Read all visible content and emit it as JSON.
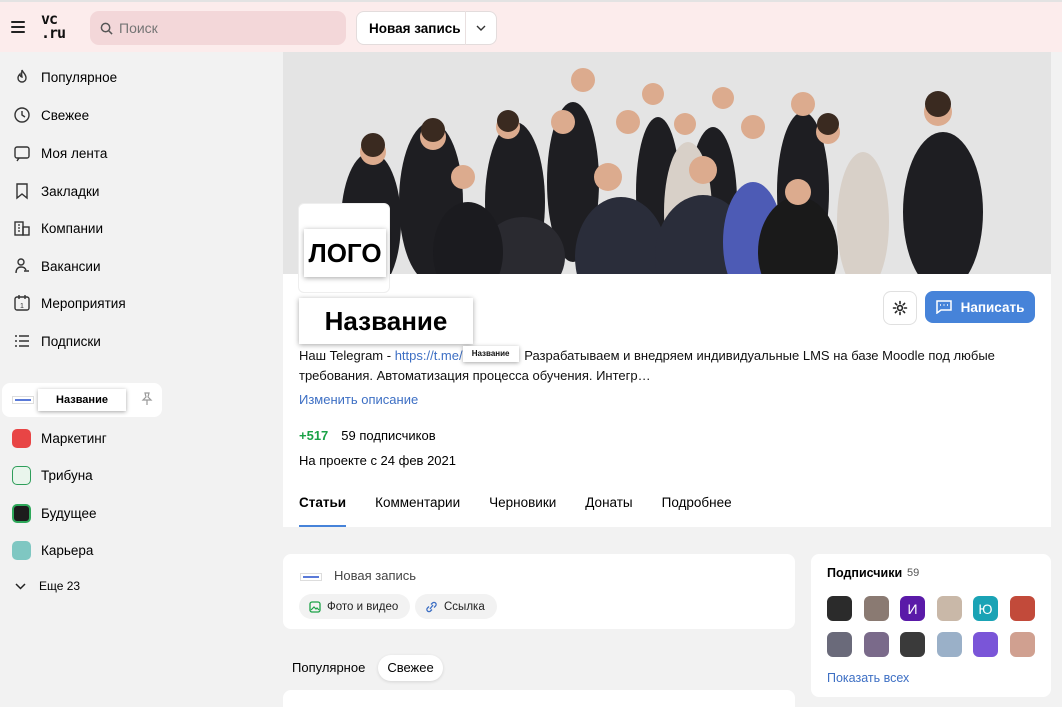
{
  "header": {
    "logo_top": "vc",
    "logo_bottom": ".ru",
    "search_placeholder": "Поиск",
    "new_post_label": "Новая запись"
  },
  "sidebar": {
    "items": [
      {
        "label": "Популярное",
        "icon": "fire-icon"
      },
      {
        "label": "Свежее",
        "icon": "clock-icon"
      },
      {
        "label": "Моя лента",
        "icon": "feed-icon"
      },
      {
        "label": "Закладки",
        "icon": "bookmark-icon"
      },
      {
        "label": "Компании",
        "icon": "building-icon"
      },
      {
        "label": "Вакансии",
        "icon": "person-icon"
      },
      {
        "label": "Мероприятия",
        "icon": "calendar-icon"
      },
      {
        "label": "Подписки",
        "icon": "list-icon"
      }
    ],
    "current_sub": "Название",
    "subs": [
      {
        "label": "Маркетинг",
        "color": "#e84545"
      },
      {
        "label": "Трибуна",
        "color": "#2e9e5a"
      },
      {
        "label": "Будущее",
        "color": "#1c1c1c"
      },
      {
        "label": "Карьера",
        "color": "#7fc7c2"
      }
    ],
    "more_label": "Еще 23"
  },
  "profile": {
    "logo_text": "ЛОГО",
    "name": "Название",
    "write_label": "Написать",
    "desc_prefix": "Наш Telegram - ",
    "desc_link": "https://t.me/",
    "desc_badge": "Название",
    "desc_rest": " Разрабатываем и внедряем индивидуальные LMS на базе Moodle под любые требования. Автоматизация процесса обучения. Интегр…",
    "edit_desc": "Изменить описание",
    "karma": "+517",
    "subscribers": "59 подписчиков",
    "since": "На проекте с 24 фев 2021",
    "tabs": [
      "Статьи",
      "Комментарии",
      "Черновики",
      "Донаты",
      "Подробнее"
    ]
  },
  "composer": {
    "placeholder": "Новая запись",
    "photo_label": "Фото и видео",
    "link_label": "Ссылка"
  },
  "feed_tabs": [
    "Популярное",
    "Свежее"
  ],
  "subs_widget": {
    "title": "Подписчики",
    "count": "59",
    "show_all": "Показать всех",
    "avatars": [
      {
        "letter": "",
        "color": "#2b2b2b"
      },
      {
        "letter": "",
        "color": "#8a7a72"
      },
      {
        "letter": "И",
        "color": "#5a1aa8"
      },
      {
        "letter": "",
        "color": "#c9b8a8"
      },
      {
        "letter": "Ю",
        "color": "#1aa3b5"
      },
      {
        "letter": "",
        "color": "#c24a3a"
      },
      {
        "letter": "",
        "color": "#6a6a7a"
      },
      {
        "letter": "",
        "color": "#7a6a8a"
      },
      {
        "letter": "",
        "color": "#3a3a3a"
      },
      {
        "letter": "",
        "color": "#9ab0c8"
      },
      {
        "letter": "",
        "color": "#7a55d8"
      },
      {
        "letter": "",
        "color": "#d0a090"
      }
    ]
  }
}
